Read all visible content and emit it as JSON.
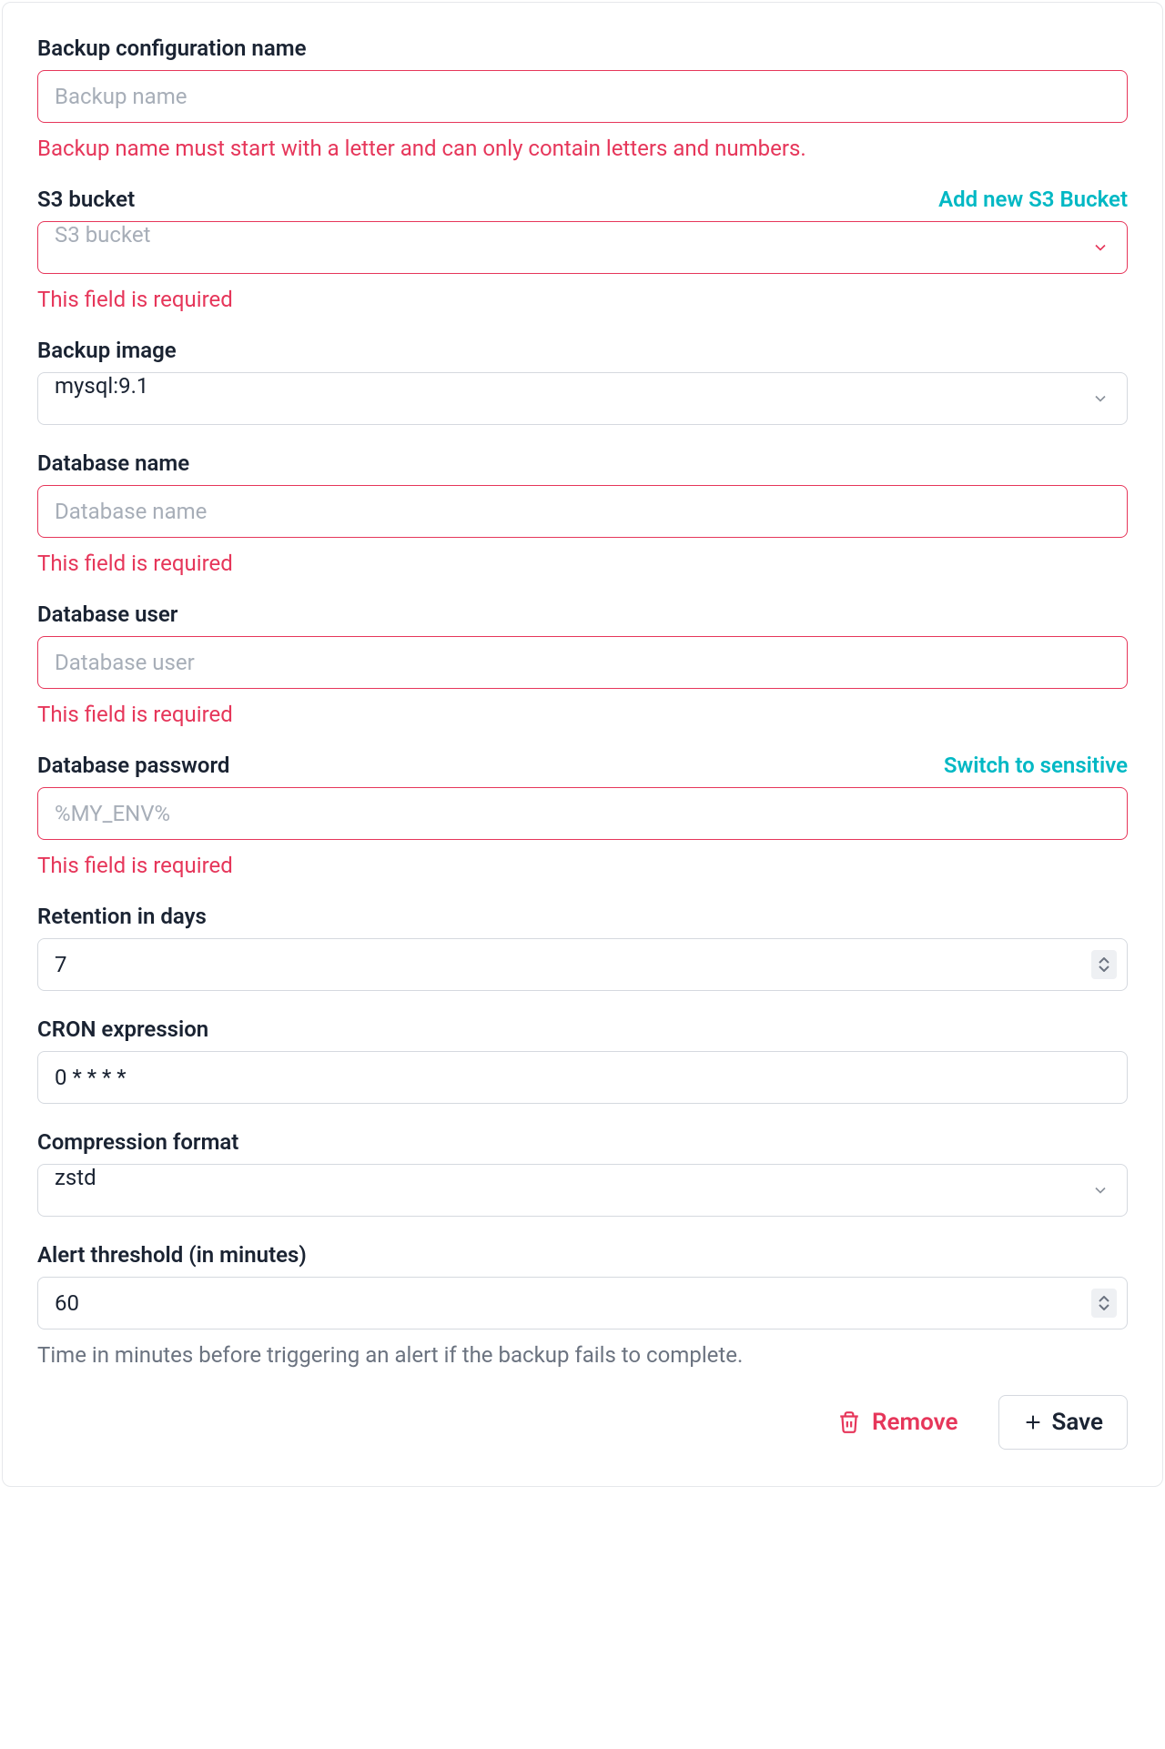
{
  "fields": {
    "backup_name": {
      "label": "Backup configuration name",
      "placeholder": "Backup name",
      "value": "",
      "error": "Backup name must start with a letter and can only contain letters and numbers."
    },
    "s3_bucket": {
      "label": "S3 bucket",
      "action": "Add new S3 Bucket",
      "placeholder": "S3 bucket",
      "value": "",
      "error": "This field is required"
    },
    "backup_image": {
      "label": "Backup image",
      "value": "mysql:9.1"
    },
    "db_name": {
      "label": "Database name",
      "placeholder": "Database name",
      "value": "",
      "error": "This field is required"
    },
    "db_user": {
      "label": "Database user",
      "placeholder": "Database user",
      "value": "",
      "error": "This field is required"
    },
    "db_password": {
      "label": "Database password",
      "action": "Switch to sensitive",
      "placeholder": "%MY_ENV%",
      "value": "",
      "error": "This field is required"
    },
    "retention": {
      "label": "Retention in days",
      "value": "7"
    },
    "cron": {
      "label": "CRON expression",
      "value": "0 * * * *"
    },
    "compression": {
      "label": "Compression format",
      "value": "zstd"
    },
    "alert_threshold": {
      "label": "Alert threshold (in minutes)",
      "value": "60",
      "helper": "Time in minutes before triggering an alert if the backup fails to complete."
    }
  },
  "buttons": {
    "remove": "Remove",
    "save": "Save"
  }
}
